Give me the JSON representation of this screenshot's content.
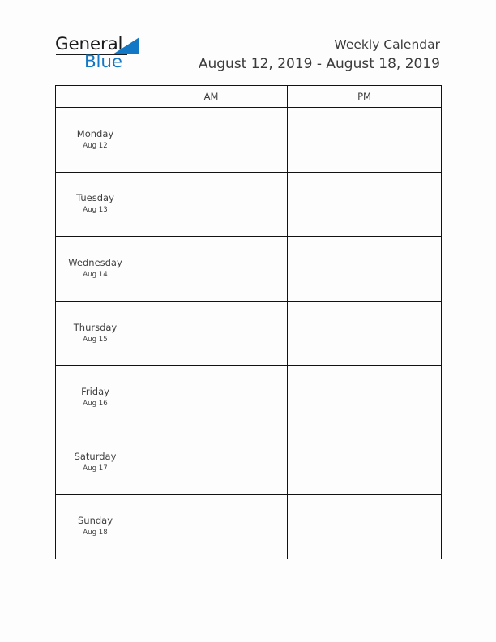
{
  "brand": {
    "name_part1": "General",
    "name_part2": "Blue",
    "triangle_color": "#1277c4",
    "text_color": "#1b1b1b",
    "blue_color": "#1277c4"
  },
  "header": {
    "title": "Weekly Calendar",
    "date_range": "August 12, 2019 - August 18, 2019"
  },
  "table": {
    "columns": [
      {
        "key": "day",
        "label": ""
      },
      {
        "key": "am",
        "label": "AM"
      },
      {
        "key": "pm",
        "label": "PM"
      }
    ],
    "rows": [
      {
        "day": "Monday",
        "date": "Aug 12",
        "am": "",
        "pm": ""
      },
      {
        "day": "Tuesday",
        "date": "Aug 13",
        "am": "",
        "pm": ""
      },
      {
        "day": "Wednesday",
        "date": "Aug 14",
        "am": "",
        "pm": ""
      },
      {
        "day": "Thursday",
        "date": "Aug 15",
        "am": "",
        "pm": ""
      },
      {
        "day": "Friday",
        "date": "Aug 16",
        "am": "",
        "pm": ""
      },
      {
        "day": "Saturday",
        "date": "Aug 17",
        "am": "",
        "pm": ""
      },
      {
        "day": "Sunday",
        "date": "Aug 18",
        "am": "",
        "pm": ""
      }
    ]
  },
  "colors": {
    "page_background": "#fdfdfd",
    "border": "#121212",
    "text": "#3f3f3f"
  }
}
